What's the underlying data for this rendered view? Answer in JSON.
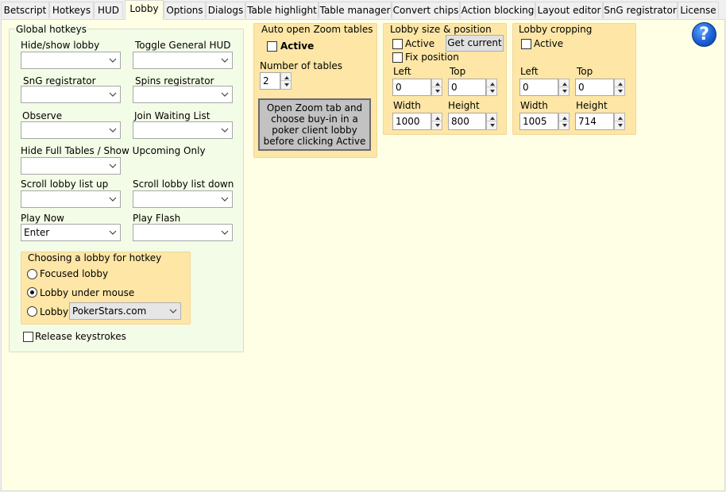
{
  "tabs": [
    {
      "label": "Betscript",
      "active": false
    },
    {
      "label": "Hotkeys",
      "active": false
    },
    {
      "label": "HUD",
      "active": false
    },
    {
      "label": "Lobby",
      "active": true
    },
    {
      "label": "Options",
      "active": false
    },
    {
      "label": "Dialogs",
      "active": false
    },
    {
      "label": "Table highlight",
      "active": false
    },
    {
      "label": "Table manager",
      "active": false
    },
    {
      "label": "Convert chips",
      "active": false
    },
    {
      "label": "Action blocking",
      "active": false
    },
    {
      "label": "Layout editor",
      "active": false
    },
    {
      "label": "SnG registrator",
      "active": false
    },
    {
      "label": "License",
      "active": false
    }
  ],
  "global_hotkeys": {
    "title": "Global hotkeys",
    "hide_show_lobby": {
      "label": "Hide/show lobby",
      "value": ""
    },
    "toggle_general_hud": {
      "label": "Toggle General HUD",
      "value": ""
    },
    "sng_registrator": {
      "label": "SnG registrator",
      "value": ""
    },
    "spins_registrator": {
      "label": "Spins registrator",
      "value": ""
    },
    "observe": {
      "label": "Observe",
      "value": ""
    },
    "join_waiting_list": {
      "label": "Join Waiting List",
      "value": ""
    },
    "hide_full_tables": {
      "label": "Hide Full Tables / Show Upcoming Only",
      "value": ""
    },
    "scroll_up": {
      "label": "Scroll lobby list up",
      "value": ""
    },
    "scroll_down": {
      "label": "Scroll lobby list down",
      "value": ""
    },
    "play_now": {
      "label": "Play Now",
      "value": "Enter"
    },
    "play_flash": {
      "label": "Play Flash",
      "value": ""
    },
    "choosing_lobby": {
      "title": "Choosing a lobby for hotkey",
      "focused_lobby": "Focused lobby",
      "lobby_under_mouse": "Lobby under mouse",
      "lobby": "Lobby",
      "lobby_value": "PokerStars.com",
      "selected": "lobby_under_mouse"
    },
    "release_keystrokes": {
      "label": "Release keystrokes",
      "checked": false
    }
  },
  "auto_zoom": {
    "title": "Auto open Zoom tables",
    "active_label": "Active",
    "active_checked": false,
    "num_tables_label": "Number of tables",
    "num_tables_value": "2",
    "info_line1": "Open Zoom tab and",
    "info_line2": "choose buy-in in a",
    "info_line3": "poker client lobby",
    "info_line4": "before clicking Active"
  },
  "lobby_size": {
    "title": "Lobby size & position",
    "active_label": "Active",
    "active_checked": false,
    "get_current": "Get current",
    "fix_position_label": "Fix position",
    "fix_position_checked": false,
    "left_label": "Left",
    "left_value": "0",
    "top_label": "Top",
    "top_value": "0",
    "width_label": "Width",
    "width_value": "1000",
    "height_label": "Height",
    "height_value": "800"
  },
  "lobby_cropping": {
    "title": "Lobby cropping",
    "active_label": "Active",
    "active_checked": false,
    "left_label": "Left",
    "left_value": "0",
    "top_label": "Top",
    "top_value": "0",
    "width_label": "Width",
    "width_value": "1005",
    "height_label": "Height",
    "height_value": "714"
  },
  "help": {
    "icon": "help-icon",
    "glyph": "?"
  }
}
